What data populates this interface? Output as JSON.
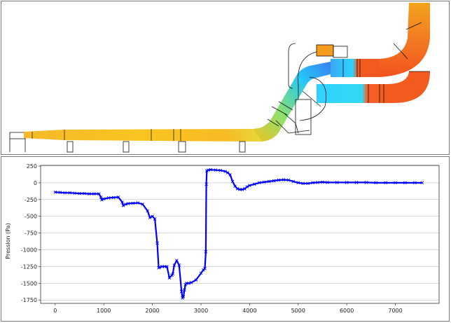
{
  "chart_data": {
    "type": "line",
    "title": "",
    "xlabel": "",
    "ylabel": "Pression (Pa)",
    "xlim": [
      -300,
      7900
    ],
    "ylim": [
      -1800,
      260
    ],
    "x_ticks": [
      0,
      1000,
      2000,
      3000,
      4000,
      5000,
      6000,
      7000
    ],
    "y_ticks": [
      250,
      0,
      -250,
      -500,
      -750,
      -1000,
      -1250,
      -1500,
      -1750
    ],
    "grid": "horizontal",
    "series": [
      {
        "color": "#0000ff",
        "marker": "x",
        "x": [
          0,
          100,
          200,
          300,
          400,
          500,
          600,
          700,
          800,
          900,
          940,
          960,
          1000,
          1100,
          1200,
          1300,
          1380,
          1400,
          1450,
          1500,
          1600,
          1700,
          1800,
          1900,
          1950,
          2000,
          2050,
          2100,
          2130,
          2150,
          2200,
          2250,
          2300,
          2350,
          2400,
          2420,
          2450,
          2500,
          2550,
          2600,
          2620,
          2640,
          2660,
          2680,
          2700,
          2750,
          2800,
          2900,
          3000,
          3050,
          3080,
          3100,
          3110,
          3120,
          3150,
          3200,
          3300,
          3400,
          3500,
          3550,
          3600,
          3650,
          3700,
          3750,
          3800,
          3850,
          3900,
          3950,
          4000,
          4100,
          4200,
          4300,
          4400,
          4500,
          4600,
          4700,
          4800,
          4900,
          5000,
          5100,
          5200,
          5300,
          5400,
          5500,
          5600,
          5800,
          6000,
          6200,
          6400,
          6600,
          6800,
          7000,
          7200,
          7400,
          7550
        ],
        "y": [
          -140,
          -145,
          -150,
          -150,
          -155,
          -160,
          -160,
          -165,
          -165,
          -165,
          -215,
          -255,
          -240,
          -225,
          -220,
          -215,
          -290,
          -340,
          -320,
          -310,
          -305,
          -300,
          -320,
          -420,
          -520,
          -500,
          -540,
          -900,
          -1270,
          -1260,
          -1250,
          -1250,
          -1250,
          -1420,
          -1380,
          -1360,
          -1230,
          -1160,
          -1230,
          -1620,
          -1720,
          -1700,
          -1600,
          -1520,
          -1500,
          -1500,
          -1490,
          -1450,
          -1350,
          -1300,
          -1280,
          -1030,
          -20,
          180,
          190,
          195,
          190,
          185,
          170,
          150,
          120,
          20,
          -50,
          -90,
          -100,
          -100,
          -90,
          -60,
          -40,
          -20,
          0,
          10,
          20,
          30,
          40,
          45,
          40,
          20,
          0,
          -10,
          -10,
          0,
          5,
          10,
          5,
          5,
          5,
          5,
          5,
          0,
          0,
          0,
          0,
          0,
          0
        ]
      }
    ]
  },
  "diagram": {
    "gradient_colors": [
      "#f4b92a",
      "#f9c01e",
      "#9be064",
      "#22c7f5",
      "#2bd3ff",
      "#f25a1f",
      "#f4622a",
      "#f0a41c"
    ]
  }
}
